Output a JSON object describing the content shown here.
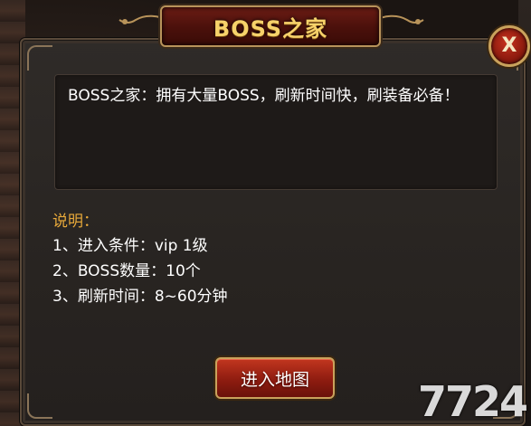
{
  "dialog": {
    "title": "BOSS之家",
    "close_label": "X",
    "description": "BOSS之家：拥有大量BOSS，刷新时间快，刷装备必备！",
    "notes_heading": "说明：",
    "notes": [
      "1、进入条件：vip 1级",
      "2、BOSS数量：10个",
      "3、刷新时间：8~60分钟"
    ],
    "enter_button_label": "进入地图"
  },
  "watermark": "7724",
  "icons": {
    "close": "close-icon"
  },
  "colors": {
    "title_text": "#f7d26a",
    "notes_heading": "#e8a93a",
    "button_red": "#8e1c10",
    "gold_border": "#c9a25c"
  }
}
